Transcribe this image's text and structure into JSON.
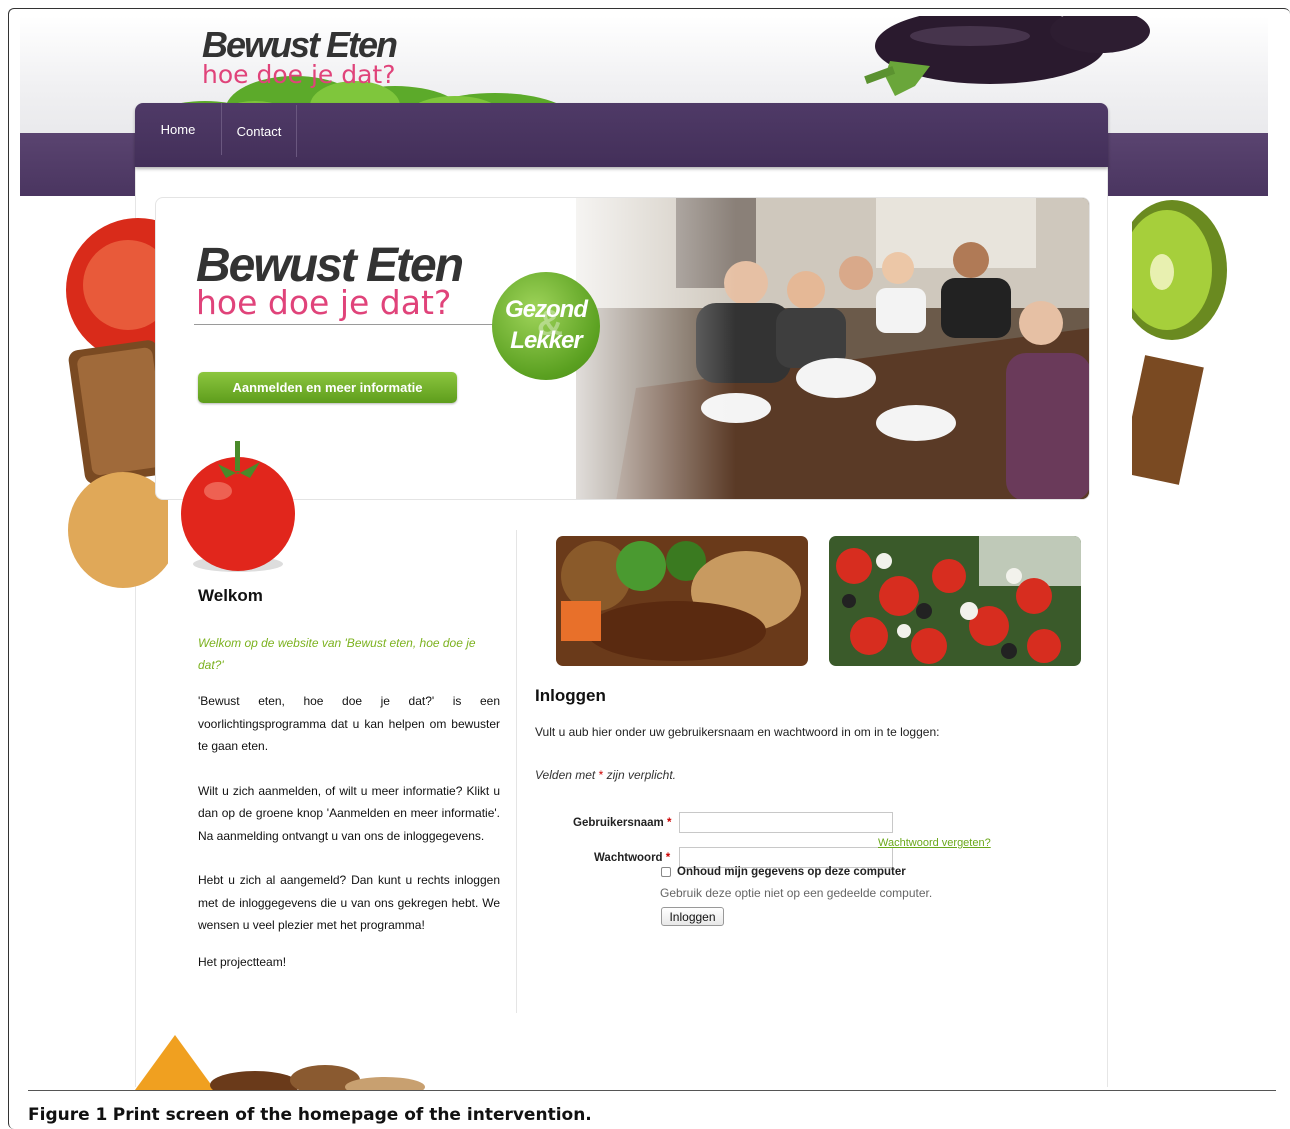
{
  "logo": {
    "title": "Bewust Eten",
    "subtitle": "hoe doe je dat?"
  },
  "nav": {
    "items": [
      {
        "label": "Home"
      },
      {
        "label": "Contact"
      }
    ]
  },
  "hero": {
    "badge_line1": "Gezond",
    "badge_amp": "&",
    "badge_line2": "Lekker",
    "cta_label": "Aanmelden en meer informatie"
  },
  "welcome": {
    "title": "Welkom",
    "intro": "Welkom op de website van 'Bewust eten, hoe doe je dat?'",
    "p1": "'Bewust eten, hoe doe je dat?' is een voorlichtingsprogramma dat u kan helpen om bewuster te gaan eten.",
    "p2": "Wilt u zich aanmelden, of wilt u meer informatie? Klikt u dan op de groene knop 'Aanmelden en meer informatie'. Na aanmelding ontvangt u van ons de inloggegevens.",
    "p3": "Hebt u zich al aangemeld? Dan kunt u rechts inloggen met de inloggegevens die u van ons gekregen hebt. We wensen u veel plezier met het programma!",
    "signature": "Het projectteam!"
  },
  "login": {
    "title": "Inloggen",
    "instructions": "Vult u aub hier onder uw gebruikersnaam en wachtwoord in om in te loggen:",
    "required_prefix": "Velden met",
    "required_star": "*",
    "required_suffix": "zijn verplicht.",
    "username_label": "Gebruikersnaam",
    "password_label": "Wachtwoord",
    "username_value": "",
    "password_value": "",
    "forgot_link": "Wachtwoord vergeten?",
    "remember_label": "Onhoud mijn gegevens op deze computer",
    "remember_checked": false,
    "hint": "Gebruik deze optie niet op een gedeelde computer.",
    "submit_label": "Inloggen"
  },
  "caption": {
    "bold": "Figure 1",
    "text": "Print screen of the homepage of the intervention."
  },
  "colors": {
    "nav_purple": "#4f3a67",
    "accent_green": "#7cb21f",
    "logo_pink": "#e0437a"
  }
}
